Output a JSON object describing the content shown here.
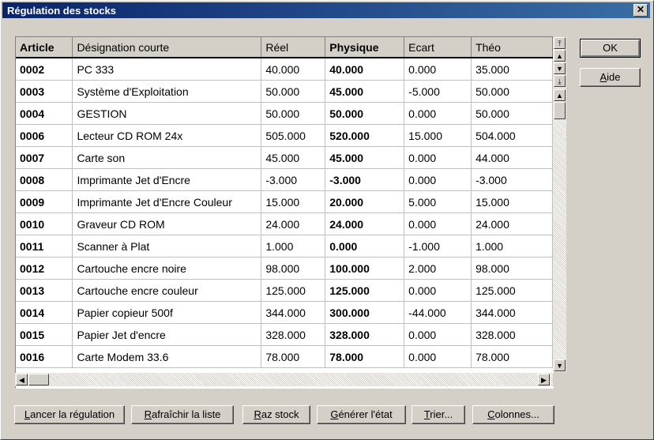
{
  "window": {
    "title": "Régulation des stocks",
    "close_glyph": "✕"
  },
  "table": {
    "columns": [
      {
        "label": "Article",
        "bold": true
      },
      {
        "label": "Désignation courte",
        "bold": false
      },
      {
        "label": "Réel",
        "bold": false
      },
      {
        "label": "Physique",
        "bold": true
      },
      {
        "label": "Ecart",
        "bold": false
      },
      {
        "label": "Théo",
        "bold": false
      }
    ],
    "rows": [
      [
        "0002",
        "PC 333",
        "40.000",
        "40.000",
        "0.000",
        "35.000"
      ],
      [
        "0003",
        "Système d'Exploitation",
        "50.000",
        "45.000",
        "-5.000",
        "50.000"
      ],
      [
        "0004",
        "GESTION",
        "50.000",
        "50.000",
        "0.000",
        "50.000"
      ],
      [
        "0006",
        "Lecteur CD ROM 24x",
        "505.000",
        "520.000",
        "15.000",
        "504.000"
      ],
      [
        "0007",
        "Carte son",
        "45.000",
        "45.000",
        "0.000",
        "44.000"
      ],
      [
        "0008",
        "Imprimante Jet d'Encre",
        "-3.000",
        "-3.000",
        "0.000",
        "-3.000"
      ],
      [
        "0009",
        "Imprimante Jet d'Encre Couleur",
        "15.000",
        "20.000",
        "5.000",
        "15.000"
      ],
      [
        "0010",
        "Graveur CD ROM",
        "24.000",
        "24.000",
        "0.000",
        "24.000"
      ],
      [
        "0011",
        "Scanner à Plat",
        "1.000",
        "0.000",
        "-1.000",
        "1.000"
      ],
      [
        "0012",
        "Cartouche encre noire",
        "98.000",
        "100.000",
        "2.000",
        "98.000"
      ],
      [
        "0013",
        "Cartouche encre couleur",
        "125.000",
        "125.000",
        "0.000",
        "125.000"
      ],
      [
        "0014",
        "Papier copieur 500f",
        "344.000",
        "300.000",
        "-44.000",
        "344.000"
      ],
      [
        "0015",
        "Papier Jet d'encre",
        "328.000",
        "328.000",
        "0.000",
        "328.000"
      ],
      [
        "0016",
        "Carte Modem 33.6",
        "78.000",
        "78.000",
        "0.000",
        "78.000"
      ]
    ]
  },
  "side_buttons": {
    "ok": "OK",
    "aide_key": "A",
    "aide_rest": "ide"
  },
  "bottom_buttons": {
    "lancer_key": "L",
    "lancer_rest": "ancer la régulation",
    "rafraichir_key": "R",
    "rafraichir_rest": "afraîchir la liste",
    "raz_key": "R",
    "raz_rest": "az stock",
    "generer_key": "G",
    "generer_rest": "énérer l'état",
    "trier_key": "T",
    "trier_rest": "rier...",
    "colonnes_key": "C",
    "colonnes_rest": "olonnes..."
  },
  "scroll_glyphs": {
    "top": "⤒",
    "page_up": "▲",
    "page_down": "▼",
    "bottom": "⤓",
    "up": "▲",
    "down": "▼",
    "left": "◀",
    "right": "▶"
  }
}
